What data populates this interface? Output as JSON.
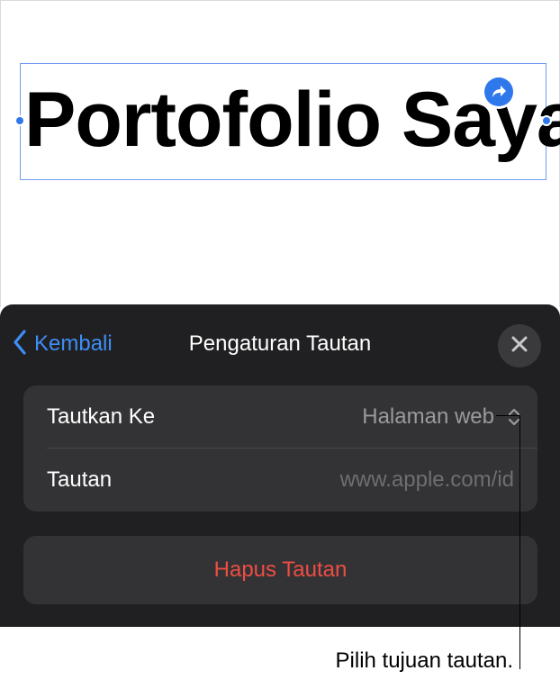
{
  "canvas": {
    "title": "Portofolio Saya"
  },
  "panel": {
    "back_label": "Kembali",
    "title": "Pengaturan Tautan",
    "rows": [
      {
        "label": "Tautkan Ke",
        "value": "Halaman web"
      },
      {
        "label": "Tautan",
        "value": "www.apple.com/id"
      }
    ],
    "remove_label": "Hapus Tautan"
  },
  "callout": {
    "text": "Pilih tujuan tautan."
  },
  "icons": {
    "back": "chevron-left-icon",
    "close": "close-icon",
    "stepper": "chevron-up-down-icon",
    "link": "link-arrow-icon"
  },
  "colors": {
    "accent": "#3d8ef5",
    "destructive": "#ee4d44",
    "panel_bg": "#202022",
    "row_bg": "#333335"
  }
}
